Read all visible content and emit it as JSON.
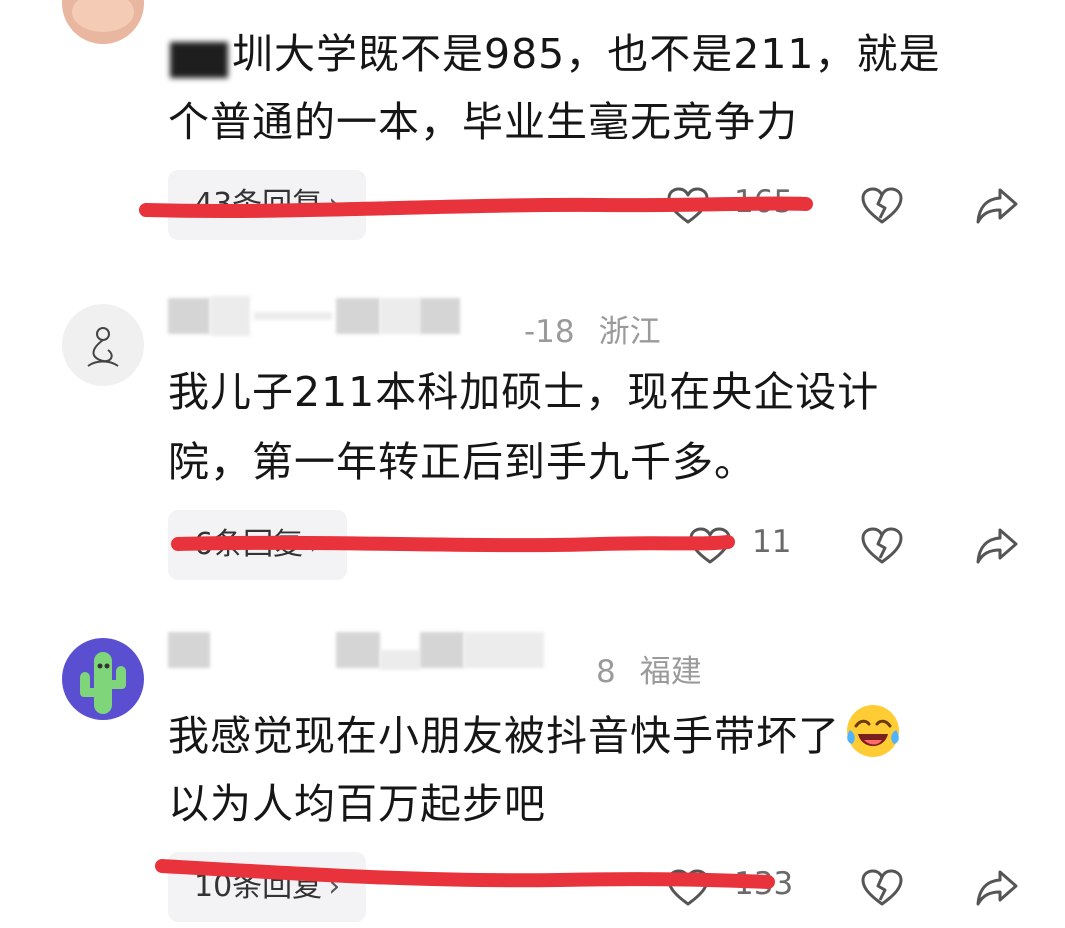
{
  "comments": [
    {
      "text_line1": "圳大学既不是985，也不是211，就是",
      "text_line2": "个普通的一本，毕业生毫无竞争力",
      "replies_label": "43条回复",
      "like_count": "165"
    },
    {
      "time_suffix": "-18",
      "region": "浙江",
      "text_line1": "我儿子211本科加硕士，现在央企设计",
      "text_line2": "院，第一年转正后到手九千多。",
      "replies_label": "6条回复",
      "like_count": "11"
    },
    {
      "time_suffix": "8",
      "region": "福建",
      "text_line1": "我感觉现在小朋友被抖音快手带坏了",
      "text_line2": "以为人均百万起步吧",
      "emoji_icon": "laughing-crying-emoji-icon",
      "replies_label": "10条回复",
      "like_count": "133"
    }
  ],
  "colors": {
    "redaction_line": "#e8333c",
    "meta_text": "#9a9a9a",
    "reply_pill_bg": "#f3f3f5",
    "icon_stroke": "#555555"
  },
  "icons": {
    "like": "heart-icon",
    "dislike": "broken-heart-icon",
    "share": "share-arrow-icon",
    "chevron": "chevron-right-icon"
  }
}
